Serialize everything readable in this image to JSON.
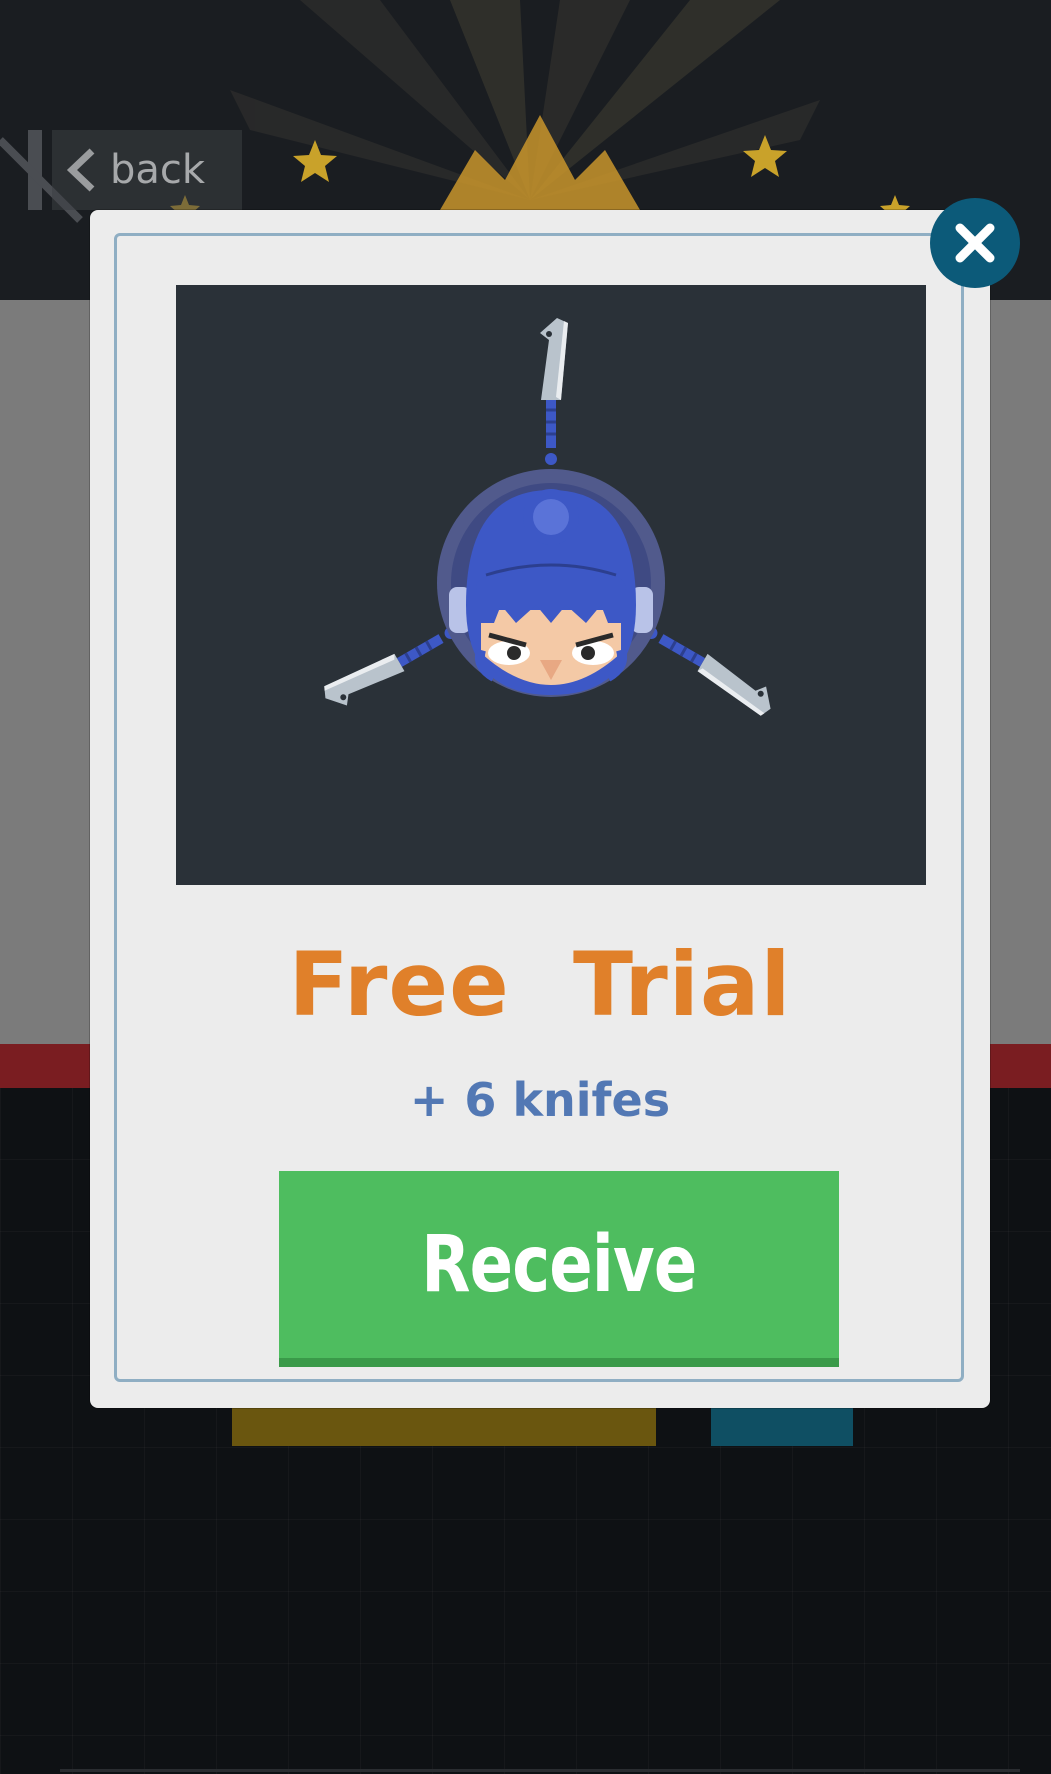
{
  "background": {
    "back_button": {
      "label": "back",
      "icon": "chevron-left-icon"
    }
  },
  "modal": {
    "close_icon": "close-icon",
    "preview": {
      "character": "ninja-avatar",
      "knife_count_shown": 3
    },
    "title": "Free  Trial",
    "subtitle": "+ 6 knifes",
    "receive_label": "Receive"
  },
  "colors": {
    "title": "#e0802a",
    "subtitle": "#5278b4",
    "receive_button": "#4ebd5f",
    "close_button": "#0c5a79",
    "preview_bg": "#2a3138",
    "ninja_hood": "#3d58c6"
  }
}
